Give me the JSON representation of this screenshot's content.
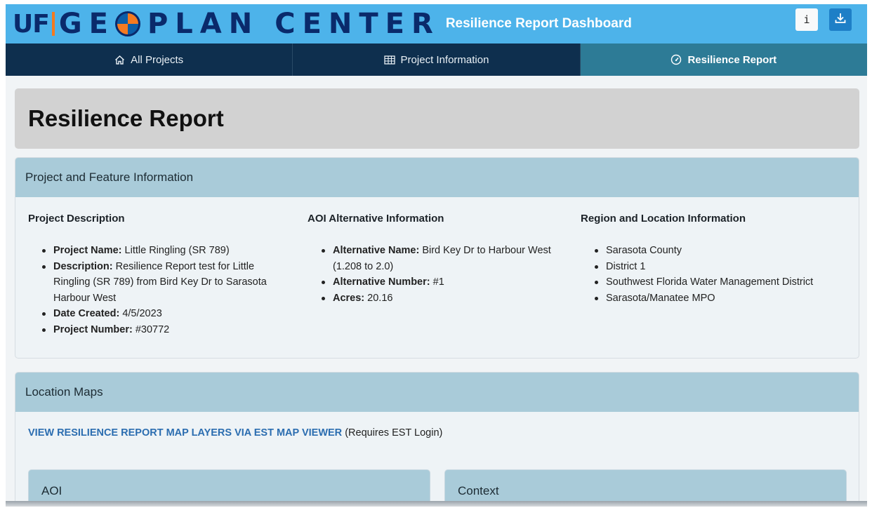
{
  "header": {
    "logo": {
      "uf": "UF",
      "word1": "GE",
      "word2": "PLAN",
      "word3": "CENTER"
    },
    "title": "Resilience Report Dashboard",
    "info_label": "i",
    "brand_color": "#4db3ea"
  },
  "nav": {
    "items": [
      {
        "label": "All Projects",
        "icon": "home-icon",
        "active": false
      },
      {
        "label": "Project Information",
        "icon": "table-icon",
        "active": false
      },
      {
        "label": "Resilience Report",
        "icon": "gauge-icon",
        "active": true
      }
    ]
  },
  "page": {
    "title": "Resilience Report"
  },
  "project_card": {
    "header": "Project and Feature Information",
    "description": {
      "heading": "Project Description",
      "items": [
        {
          "label": "Project Name:",
          "value": "Little Ringling (SR 789)"
        },
        {
          "label": "Description:",
          "value": "Resilience Report test for Little Ringling (SR 789) from Bird Key Dr to Sarasota Harbour West"
        },
        {
          "label": "Date Created:",
          "value": "4/5/2023"
        },
        {
          "label": "Project Number:",
          "value": "#30772"
        }
      ]
    },
    "aoi": {
      "heading": "AOI Alternative Information",
      "items": [
        {
          "label": "Alternative Name:",
          "value": "Bird Key Dr to Harbour West (1.208 to 2.0)"
        },
        {
          "label": "Alternative Number:",
          "value": "#1"
        },
        {
          "label": "Acres:",
          "value": "20.16"
        }
      ]
    },
    "region": {
      "heading": "Region and Location Information",
      "items": [
        "Sarasota County",
        "District 1",
        "Southwest Florida Water Management District",
        "Sarasota/Manatee MPO"
      ]
    }
  },
  "maps_card": {
    "header": "Location Maps",
    "link_text": "VIEW RESILIENCE REPORT MAP LAYERS VIA EST MAP VIEWER",
    "link_note": "(Requires EST Login)",
    "sub_cards": [
      "AOI",
      "Context"
    ]
  }
}
